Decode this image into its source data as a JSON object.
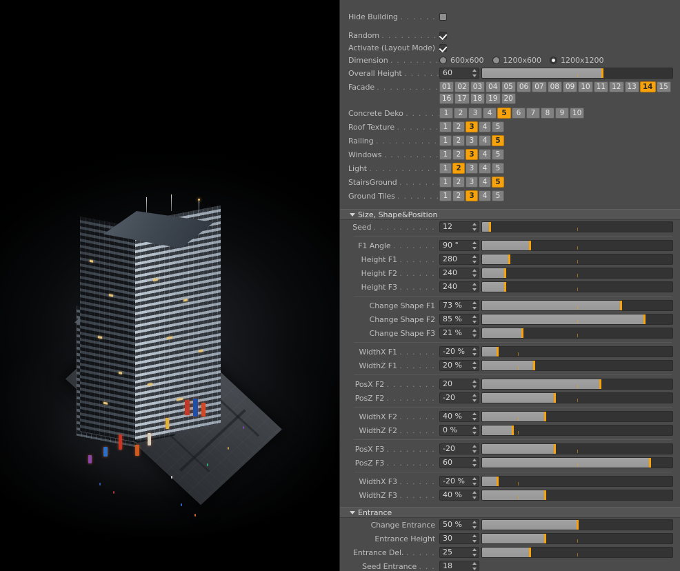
{
  "app": {
    "viewport_name": "3d-viewport",
    "scene_description": "Night-time rendered skyscraper tower on a plaza base, black background"
  },
  "panel": {
    "top_group": {
      "hide_building": {
        "label": "Hide Building",
        "dots": ". . . . . . . .",
        "checked": false
      },
      "random": {
        "label": "Random",
        "dots": ". . . . . . . . . . . .",
        "checked": true
      },
      "activate": {
        "label": "Activate (Layout Mode)",
        "dots": "",
        "checked": true
      },
      "dimension": {
        "label": "Dimension",
        "dots": ". . . . . . . . . .",
        "options": [
          {
            "label": "600x600",
            "selected": false
          },
          {
            "label": "1200x600",
            "selected": false
          },
          {
            "label": "1200x1200",
            "selected": true
          }
        ]
      },
      "overall_height": {
        "label": "Overall Height",
        "dots": ". . . . . . .",
        "value": "60",
        "fill_pct": 63,
        "knob_pct": 63,
        "tick_pct": 50
      },
      "facade": {
        "label": "Facade",
        "dots": ". . . . . . . . . . . . .",
        "options": [
          "01",
          "02",
          "03",
          "04",
          "05",
          "06",
          "07",
          "08",
          "09",
          "10",
          "11",
          "12",
          "13",
          "14",
          "15",
          "16",
          "17",
          "18",
          "19",
          "20"
        ],
        "selected": "14"
      },
      "concrete_deko": {
        "label": "Concrete Deko",
        "dots": ". . . . . . . .",
        "options": [
          "1",
          "2",
          "3",
          "4",
          "5",
          "6",
          "7",
          "8",
          "9",
          "10"
        ],
        "selected": "5"
      },
      "roof_texture": {
        "label": "Roof Texture",
        "dots": ". . . . . . . . .",
        "options": [
          "1",
          "2",
          "3",
          "4",
          "5"
        ],
        "selected": "3"
      },
      "railing": {
        "label": "Railing",
        "dots": ". . . . . . . . . . . . .",
        "options": [
          "1",
          "2",
          "3",
          "4",
          "5"
        ],
        "selected": "5"
      },
      "windows": {
        "label": "Windows",
        "dots": ". . . . . . . . . . .",
        "options": [
          "1",
          "2",
          "3",
          "4",
          "5"
        ],
        "selected": "3"
      },
      "light": {
        "label": "Light",
        "dots": ". . . . . . . . . . . . . .",
        "options": [
          "1",
          "2",
          "3",
          "4",
          "5"
        ],
        "selected": "2"
      },
      "stairs_ground": {
        "label": "StairsGround",
        "dots": ". . . . . . . .",
        "options": [
          "1",
          "2",
          "3",
          "4",
          "5"
        ],
        "selected": "5"
      },
      "ground_tiles": {
        "label": "Ground Tiles",
        "dots": ". . . . . . . .",
        "options": [
          "1",
          "2",
          "3",
          "4",
          "5"
        ],
        "selected": "3"
      }
    },
    "sections": [
      {
        "id": "size_shape_position",
        "title": "Size, Shape&Position",
        "expanded": true
      },
      {
        "id": "entrance",
        "title": "Entrance",
        "expanded": true
      }
    ],
    "size_shape_position": {
      "seed": {
        "label": "Seed",
        "dots": ". . . . . . . . . .",
        "value": "12",
        "fill_pct": 4,
        "knob_pct": 4,
        "tick_pct": 50
      },
      "f1_angle": {
        "label": "F1 Angle",
        "dots": ". . . . . . .",
        "value": "90 °",
        "fill_pct": 25,
        "knob_pct": 25,
        "tick_pct": 50
      },
      "height_f1": {
        "label": "Height F1",
        "dots": ". . . . . .",
        "value": "280",
        "fill_pct": 14,
        "knob_pct": 14,
        "tick_pct": 50
      },
      "height_f2": {
        "label": "Height F2",
        "dots": ". . . . . .",
        "value": "240",
        "fill_pct": 12,
        "knob_pct": 12,
        "tick_pct": 50
      },
      "height_f3": {
        "label": "Height F3",
        "dots": ". . . . . .",
        "value": "240",
        "fill_pct": 12,
        "knob_pct": 12,
        "tick_pct": 50
      },
      "change_shape_f1": {
        "label": "Change Shape F1",
        "dots": "",
        "value": "73 %",
        "fill_pct": 73,
        "knob_pct": 73,
        "tick_pct": 50
      },
      "change_shape_f2": {
        "label": "Change Shape F2",
        "dots": "",
        "value": "85 %",
        "fill_pct": 85,
        "knob_pct": 85,
        "tick_pct": 50
      },
      "change_shape_f3": {
        "label": "Change Shape F3",
        "dots": "",
        "value": "21 %",
        "fill_pct": 21,
        "knob_pct": 21,
        "tick_pct": 50
      },
      "widthx_f1": {
        "label": "WidthX F1",
        "dots": ". . . . . .",
        "value": "-20 %",
        "fill_pct": 8,
        "knob_pct": 8,
        "tick_pct": 19
      },
      "widthz_f1": {
        "label": "WidthZ F1",
        "dots": ". . . . . .",
        "value": "20 %",
        "fill_pct": 27,
        "knob_pct": 27,
        "tick_pct": 19
      },
      "posx_f2": {
        "label": "PosX F2",
        "dots": ". . . . . . . .",
        "value": "20",
        "fill_pct": 62,
        "knob_pct": 62,
        "tick_pct": 50
      },
      "posz_f2": {
        "label": "PosZ F2",
        "dots": ". . . . . . . .",
        "value": "-20",
        "fill_pct": 38,
        "knob_pct": 38,
        "tick_pct": 50
      },
      "widthx_f2": {
        "label": "WidthX F2",
        "dots": ". . . . . .",
        "value": "40 %",
        "fill_pct": 33,
        "knob_pct": 33,
        "tick_pct": 19
      },
      "widthz_f2": {
        "label": "WidthZ F2",
        "dots": ". . . . . .",
        "value": "0 %",
        "fill_pct": 16,
        "knob_pct": 16,
        "tick_pct": 19
      },
      "posx_f3": {
        "label": "PosX F3",
        "dots": ". . . . . . . .",
        "value": "-20",
        "fill_pct": 38,
        "knob_pct": 38,
        "tick_pct": 50
      },
      "posz_f3": {
        "label": "PosZ F3",
        "dots": ". . . . . . . .",
        "value": "60",
        "fill_pct": 88,
        "knob_pct": 88,
        "tick_pct": 50
      },
      "widthx_f3": {
        "label": "WidthX F3",
        "dots": ". . . . . .",
        "value": "-20 %",
        "fill_pct": 8,
        "knob_pct": 8,
        "tick_pct": 19
      },
      "widthz_f3": {
        "label": "WidthZ F3",
        "dots": ". . . . . .",
        "value": "40 %",
        "fill_pct": 33,
        "knob_pct": 33,
        "tick_pct": 19
      }
    },
    "entrance": {
      "change_entrance": {
        "label": "Change Entrance",
        "dots": "",
        "value": "50 %",
        "fill_pct": 50,
        "knob_pct": 50,
        "tick_pct": 50
      },
      "entrance_height": {
        "label": "Entrance Height",
        "dots": "",
        "value": "30",
        "fill_pct": 33,
        "knob_pct": 33,
        "tick_pct": 50
      },
      "entrance_del": {
        "label": "Entrance Del.",
        "dots": ". . . . .",
        "value": "25",
        "fill_pct": 25,
        "knob_pct": 25,
        "tick_pct": 50
      },
      "seed_entrance": {
        "label": "Seed Entrance",
        "dots": ". . .",
        "value": "18",
        "has_slider": false
      }
    }
  },
  "colors": {
    "panel_bg": "#4b4b4b",
    "accent_orange": "#f7a20a",
    "slider_track": "#333333",
    "slider_fill": "#9c9c9c",
    "button_bg": "#808080",
    "text": "#c8c8c8",
    "section_bg": "#545454",
    "viewport_bg": "#000000"
  }
}
